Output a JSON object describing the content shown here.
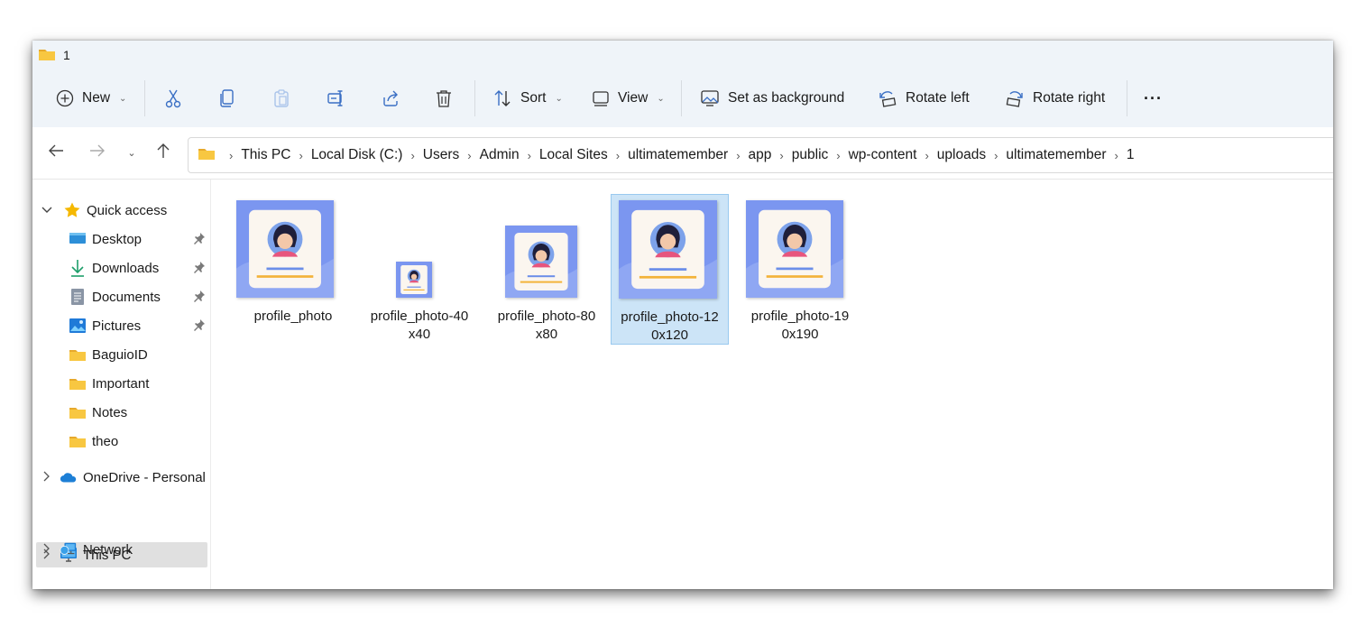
{
  "window": {
    "title": "1"
  },
  "toolbar": {
    "new_label": "New",
    "sort_label": "Sort",
    "view_label": "View",
    "set_background_label": "Set as background",
    "rotate_left_label": "Rotate left",
    "rotate_right_label": "Rotate right",
    "more_label": "···"
  },
  "breadcrumb": [
    "This PC",
    "Local Disk (C:)",
    "Users",
    "Admin",
    "Local Sites",
    "ultimatemember",
    "app",
    "public",
    "wp-content",
    "uploads",
    "ultimatemember",
    "1"
  ],
  "sidebar": {
    "quick_access": "Quick access",
    "pinned": [
      "Desktop",
      "Downloads",
      "Documents",
      "Pictures"
    ],
    "folders": [
      "BaguioID",
      "Important",
      "Notes",
      "theo"
    ],
    "onedrive": "OneDrive - Personal",
    "this_pc": "This PC",
    "network": "Network"
  },
  "files": [
    {
      "line1": "profile_photo",
      "line2": ""
    },
    {
      "line1": "profile_photo-40",
      "line2": "x40"
    },
    {
      "line1": "profile_photo-80",
      "line2": "x80"
    },
    {
      "line1": "profile_photo-12",
      "line2": "0x120",
      "selected": true
    },
    {
      "line1": "profile_photo-19",
      "line2": "0x190"
    }
  ],
  "colors": {
    "accent": "#0067c0",
    "selection": "#cce4f7",
    "folder": "#f8c741",
    "thumb_bg": "#7b96f0"
  }
}
